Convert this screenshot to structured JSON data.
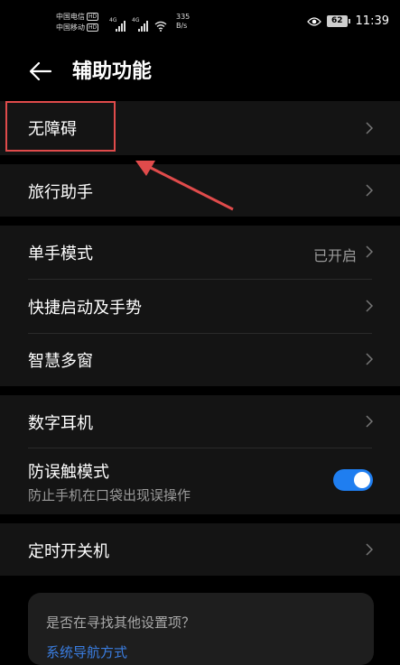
{
  "status_bar": {
    "carrier1": "中国电信",
    "carrier2": "中国移动",
    "hd": "HD",
    "net1": "4G",
    "net2": "4G",
    "speed_value": "335",
    "speed_unit": "B/s",
    "battery": "62",
    "time": "11:39"
  },
  "header": {
    "title": "辅助功能"
  },
  "rows": {
    "accessibility": "无障碍",
    "travel_assistant": "旅行助手",
    "one_hand_mode": "单手模式",
    "one_hand_mode_value": "已开启",
    "shortcuts_gestures": "快捷启动及手势",
    "smart_multiwindow": "智慧多窗",
    "digital_earphone": "数字耳机",
    "accidental_touch": "防误触模式",
    "accidental_touch_desc": "防止手机在口袋出现误操作",
    "scheduled_power": "定时开关机"
  },
  "accidental_touch_enabled": true,
  "card": {
    "question": "是否在寻找其他设置项？",
    "link": "系统导航方式"
  },
  "colors": {
    "accent": "#1f7ef0",
    "highlight": "#e04b4b",
    "link": "#3a7de0"
  }
}
